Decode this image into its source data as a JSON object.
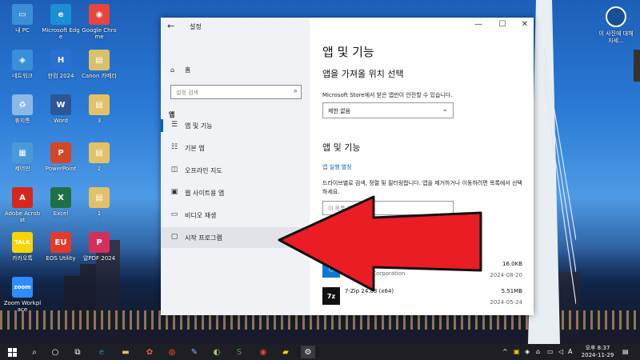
{
  "desktop": {
    "icons": [
      {
        "label": "내 PC",
        "color": "#3b8fd9",
        "glyph": "▭"
      },
      {
        "label": "Microsoft Edge",
        "color": "#1a8fd6",
        "glyph": "e"
      },
      {
        "label": "Google Chrome",
        "color": "#e8453c",
        "glyph": "◉"
      },
      {
        "label": "네트워크",
        "color": "#3b8fd9",
        "glyph": "◈"
      },
      {
        "label": "한컴 2024",
        "color": "#2a6fd1",
        "glyph": "H"
      },
      {
        "label": "Canon 카메라",
        "color": "#d8c16a",
        "glyph": "▤"
      },
      {
        "label": "휴지통",
        "color": "#8bb9e6",
        "glyph": "♻"
      },
      {
        "label": "Word",
        "color": "#2b5797",
        "glyph": "W"
      },
      {
        "label": "3",
        "color": "#e3c168",
        "glyph": "▤"
      },
      {
        "label": "제어판",
        "color": "#4a9ad8",
        "glyph": "▦"
      },
      {
        "label": "PowerPoint",
        "color": "#d24726",
        "glyph": "P"
      },
      {
        "label": "2",
        "color": "#e3c168",
        "glyph": "▤"
      },
      {
        "label": "Adobe Acrobat",
        "color": "#d8261c",
        "glyph": "A"
      },
      {
        "label": "Excel",
        "color": "#1e7145",
        "glyph": "X"
      },
      {
        "label": "1",
        "color": "#e3c168",
        "glyph": "▤"
      },
      {
        "label": "카카오톡",
        "color": "#f6d600",
        "glyph": "TALK"
      },
      {
        "label": "EOS Utility",
        "color": "#e53a2a",
        "glyph": "EU"
      },
      {
        "label": "알PDF 2024",
        "color": "#d32f5a",
        "glyph": "P"
      },
      {
        "label": "Zoom Workplace",
        "color": "#2d8cff",
        "glyph": "zoom"
      }
    ],
    "photo_info": {
      "label": "이 사진에 대해 자세..."
    }
  },
  "window": {
    "title": "설정",
    "controls": {
      "min": "—",
      "max": "☐",
      "close": "✕"
    },
    "nav": {
      "home": "홈",
      "search_placeholder": "설정 검색",
      "section": "앱",
      "items": [
        {
          "label": "앱 및 기능",
          "icon": "list-icon",
          "glyph": "☰"
        },
        {
          "label": "기본 앱",
          "icon": "default-apps-icon",
          "glyph": "☷"
        },
        {
          "label": "오프라인 지도",
          "icon": "map-icon",
          "glyph": "◫"
        },
        {
          "label": "웹 사이트용 앱",
          "icon": "web-app-icon",
          "glyph": "▣"
        },
        {
          "label": "비디오 재생",
          "icon": "video-icon",
          "glyph": "▭"
        },
        {
          "label": "시작 프로그램",
          "icon": "startup-icon",
          "glyph": "▢"
        }
      ]
    },
    "content": {
      "title": "앱 및 기능",
      "install_heading": "앱을 가져올 위치 선택",
      "install_desc": "Microsoft Store에서 받은 앱만이 안전할 수 있습니다.",
      "install_value": "제한 없음",
      "apps_heading": "앱 및 기능",
      "alias_link": "앱 실행 별칭",
      "apps_desc": "드라이브별로 검색, 정렬 및 필터링합니다. 앱을 제거하거나 이동하려면 목록에서 선택하세요.",
      "apps_search_placeholder": "이 목록 검색",
      "apps": [
        {
          "name": "",
          "publisher": "Microsoft Corporation",
          "size": "16.0KB",
          "date": "2024-08-20",
          "color": "#0a78d7",
          "glyph": "⬡"
        },
        {
          "name": "7-Zip 24.03 (x64)",
          "publisher": "",
          "size": "5.51MB",
          "date": "2024-05-24",
          "color": "#111111",
          "glyph": "7z"
        }
      ]
    }
  },
  "taskbar": {
    "clock_time": "오후 8:37",
    "clock_date": "2024-11-29"
  }
}
